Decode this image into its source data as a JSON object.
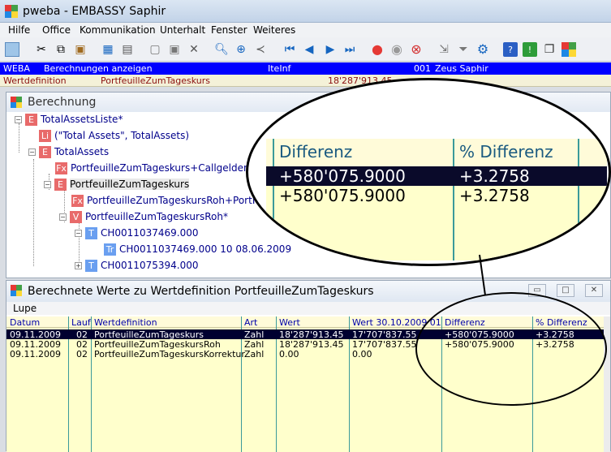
{
  "window": {
    "title": "pweba - EMBASSY Saphir"
  },
  "menu": [
    "Hilfe",
    "Office",
    "Kommunikation",
    "Unterhalt",
    "Fenster",
    "Weiteres"
  ],
  "status": {
    "row1": [
      "WEBA",
      "Berechnungen anzeigen",
      "IteInf",
      "001",
      "Zeus Saphir"
    ],
    "row2": [
      "Wertdefinition",
      "PortfeuilleZumTageskurs",
      "18'287'913.45"
    ]
  },
  "berechnung": {
    "title": "Berechnung",
    "tree": [
      {
        "badge": "E",
        "color": "red",
        "label": "TotalAssetsListe*"
      },
      {
        "badge": "Li",
        "color": "red",
        "label": "(\"Total Assets\", TotalAssets)"
      },
      {
        "badge": "E",
        "color": "red",
        "label": "TotalAssets"
      },
      {
        "badge": "Fx",
        "color": "red",
        "label": "PortfeuilleZumTageskurs+CallgeldenFx..."
      },
      {
        "badge": "E",
        "color": "red",
        "label": "PortfeuilleZumTageskurs"
      },
      {
        "badge": "Fx",
        "color": "red",
        "label": "PortfeuilleZumTageskursRoh+PortFx..."
      },
      {
        "badge": "V",
        "color": "red",
        "label": "PortfeuilleZumTageskursRoh*"
      },
      {
        "badge": "T",
        "color": "blue",
        "label": "CH0011037469.000"
      },
      {
        "badge": "Tr",
        "color": "blue",
        "label": "CH0011037469.000  10  08.06.2009"
      },
      {
        "badge": "T",
        "color": "blue",
        "label": "CH0011075394.000"
      }
    ]
  },
  "berechnete": {
    "title": "Berechnete Werte zu Wertdefinition PortfeuilleZumTageskurs",
    "lupe": "Lupe",
    "columns": [
      "Datum",
      "Lauf",
      "Wertdefinition",
      "Art",
      "Wert",
      "Wert 30.10.2009 01",
      "Differenz",
      "% Differenz"
    ],
    "rows": [
      [
        "09.11.2009",
        "02",
        "PortfeuilleZumTageskurs",
        "Zahl",
        "18'287'913.45",
        "17'707'837.55",
        "+580'075.9000",
        "+3.2758"
      ],
      [
        "09.11.2009",
        "02",
        "PortfeuilleZumTageskursRoh",
        "Zahl",
        "18'287'913.45",
        "17'707'837.55",
        "+580'075.9000",
        "+3.2758"
      ],
      [
        "09.11.2009",
        "02",
        "PortfeuilleZumTageskursKorrektur",
        "Zahl",
        "0.00",
        "0.00",
        "",
        ""
      ]
    ]
  },
  "zoom": {
    "headers": [
      "Differenz",
      "% Differenz"
    ],
    "rows": [
      [
        "+580'075.9000",
        "+3.2758"
      ],
      [
        "+580'075.9000",
        "+3.2758"
      ]
    ]
  }
}
